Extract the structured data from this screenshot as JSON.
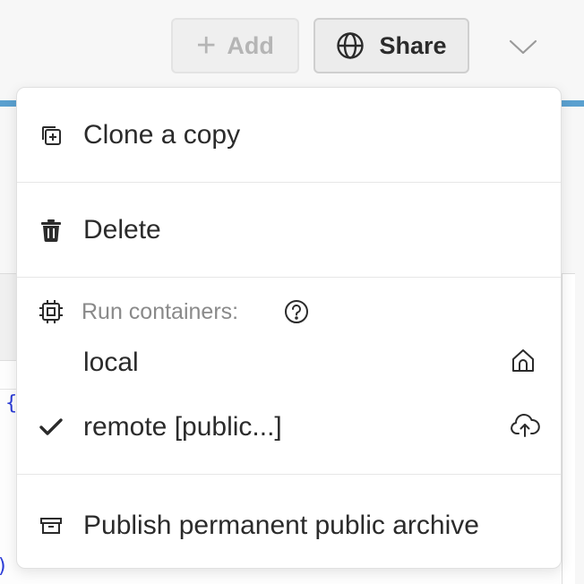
{
  "toolbar": {
    "add_label": "Add",
    "share_label": "Share"
  },
  "menu": {
    "clone_label": "Clone a copy",
    "delete_label": "Delete",
    "run_containers_label": "Run containers:",
    "containers": [
      {
        "label": "local",
        "selected": false,
        "icon": "home-icon"
      },
      {
        "label": "remote [public...]",
        "selected": true,
        "icon": "cloud-upload-icon"
      }
    ],
    "publish_label": "Publish permanent public archive"
  },
  "background": {
    "code_brace": "{",
    "code_paren": ")"
  },
  "colors": {
    "accent": "#5aa0cf",
    "code": "#2a3bd6"
  }
}
